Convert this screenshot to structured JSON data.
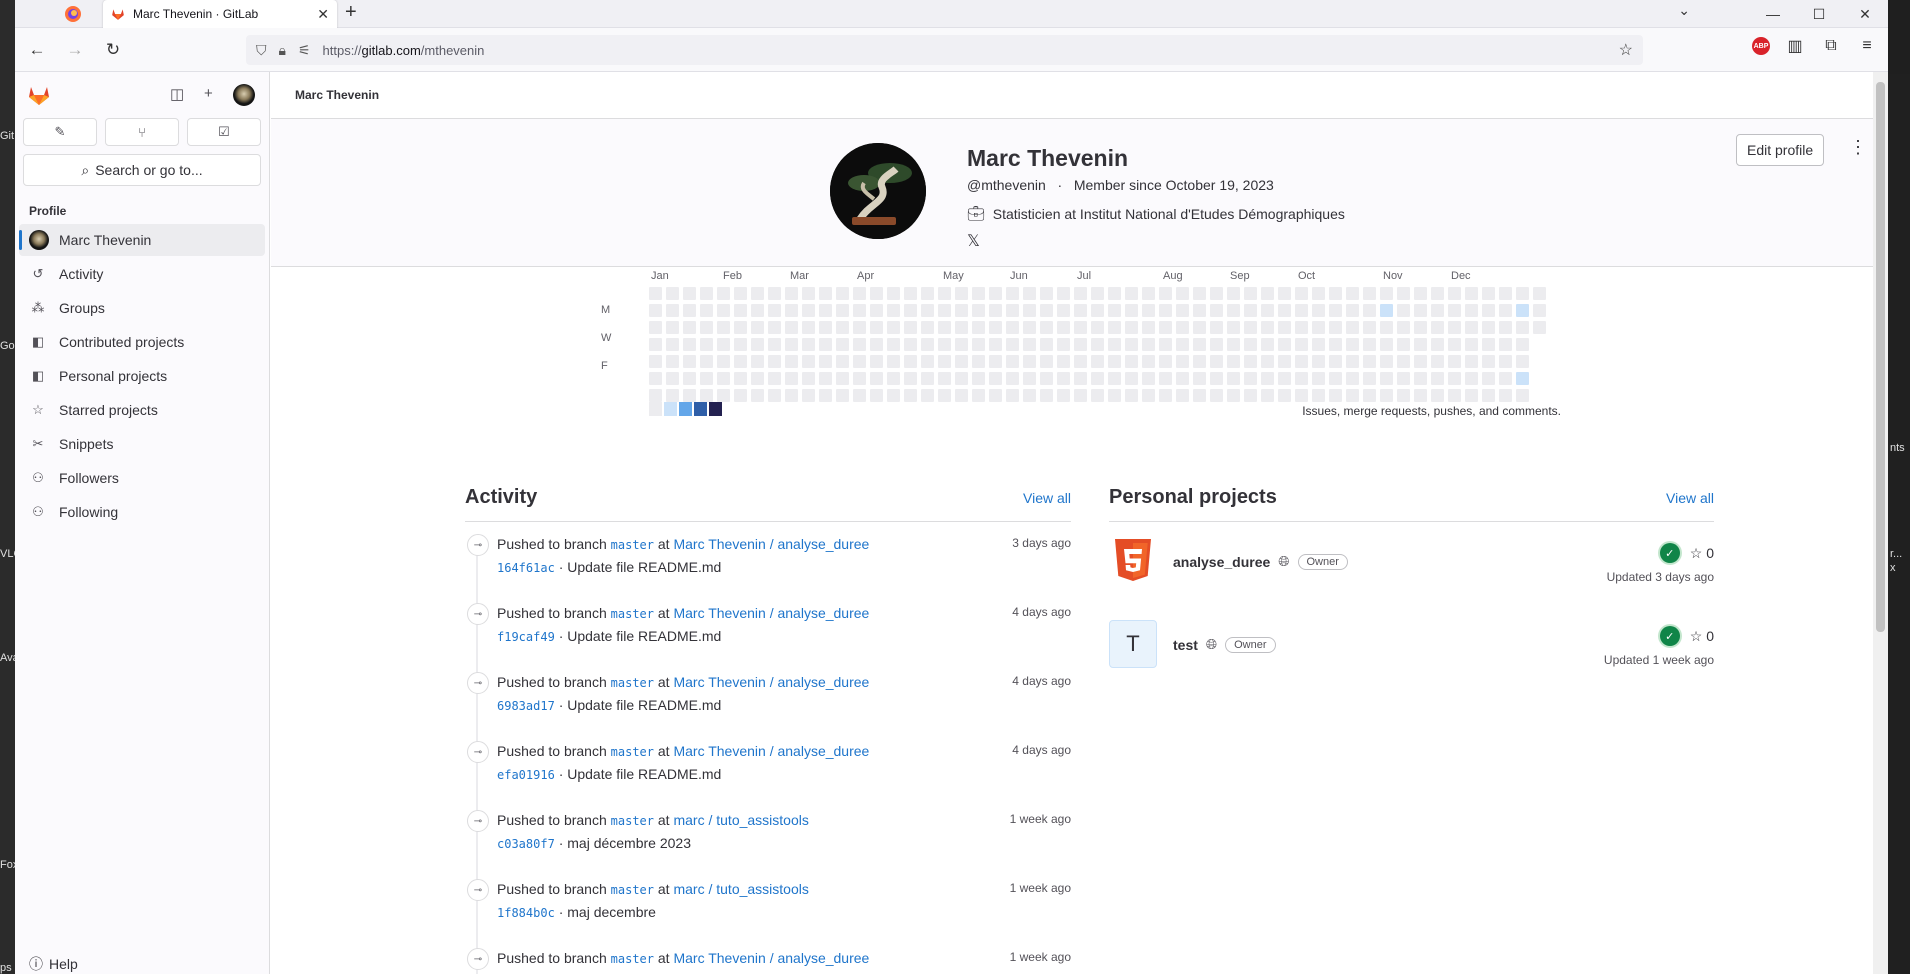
{
  "browser": {
    "tab_title": "Marc Thevenin · GitLab",
    "url_prefix": "https://",
    "url_host": "gitlab.com",
    "url_path": "/mthevenin"
  },
  "desktop_edge_labels": [
    "Git",
    "Go",
    "VLC",
    "Ava",
    "Fox",
    "ps"
  ],
  "desktop_edge_labels_right": [
    "nts",
    "r...",
    "x"
  ],
  "sidebar": {
    "search_placeholder": "Search or go to...",
    "section_label": "Profile",
    "items": [
      {
        "label": "Marc Thevenin",
        "icon": "avatar",
        "active": true
      },
      {
        "label": "Activity",
        "icon": "history-icon"
      },
      {
        "label": "Groups",
        "icon": "group-icon"
      },
      {
        "label": "Contributed projects",
        "icon": "project-icon"
      },
      {
        "label": "Personal projects",
        "icon": "project-icon"
      },
      {
        "label": "Starred projects",
        "icon": "star-icon"
      },
      {
        "label": "Snippets",
        "icon": "snippet-icon"
      },
      {
        "label": "Followers",
        "icon": "users-icon"
      },
      {
        "label": "Following",
        "icon": "users-icon"
      }
    ],
    "help_label": "Help"
  },
  "breadcrumb": "Marc Thevenin",
  "profile": {
    "name": "Marc Thevenin",
    "username": "@mthevenin",
    "member_since": "Member since October 19, 2023",
    "job": "Statisticien at Institut National d'Etudes Démographiques",
    "x_link": "𝕏",
    "edit_label": "Edit profile"
  },
  "calendar": {
    "months": [
      "Jan",
      "Feb",
      "Mar",
      "Apr",
      "May",
      "Jun",
      "Jul",
      "Aug",
      "Sep",
      "Oct",
      "Nov",
      "Dec"
    ],
    "day_labels": [
      "M",
      "W",
      "F"
    ],
    "legend_colors": [
      "#ececef",
      "#cbe2f9",
      "#63a6e9",
      "#2f5fa8",
      "#232150"
    ],
    "note": "Issues, merge requests, pushes, and comments.",
    "active_cells": [
      {
        "week": 43,
        "day": 1,
        "level": 1
      },
      {
        "week": 51,
        "day": 1,
        "level": 1
      },
      {
        "week": 51,
        "day": 5,
        "level": 1
      }
    ]
  },
  "activity": {
    "title": "Activity",
    "view_all": "View all",
    "events": [
      {
        "action": "Pushed to branch",
        "branch": "master",
        "at": "at",
        "project": "Marc Thevenin / analyse_duree",
        "time": "3 days ago",
        "sha": "164f61ac",
        "message": "· Update file README.md"
      },
      {
        "action": "Pushed to branch",
        "branch": "master",
        "at": "at",
        "project": "Marc Thevenin / analyse_duree",
        "time": "4 days ago",
        "sha": "f19caf49",
        "message": "· Update file README.md"
      },
      {
        "action": "Pushed to branch",
        "branch": "master",
        "at": "at",
        "project": "Marc Thevenin / analyse_duree",
        "time": "4 days ago",
        "sha": "6983ad17",
        "message": "· Update file README.md"
      },
      {
        "action": "Pushed to branch",
        "branch": "master",
        "at": "at",
        "project": "Marc Thevenin / analyse_duree",
        "time": "4 days ago",
        "sha": "efa01916",
        "message": "· Update file README.md"
      },
      {
        "action": "Pushed to branch",
        "branch": "master",
        "at": "at",
        "project": "marc / tuto_assistools",
        "time": "1 week ago",
        "sha": "c03a80f7",
        "message": "· maj décembre 2023"
      },
      {
        "action": "Pushed to branch",
        "branch": "master",
        "at": "at",
        "project": "marc / tuto_assistools",
        "time": "1 week ago",
        "sha": "1f884b0c",
        "message": "· maj decembre"
      },
      {
        "action": "Pushed to branch",
        "branch": "master",
        "at": "at",
        "project": "Marc Thevenin / analyse_duree",
        "time": "1 week ago",
        "sha": "",
        "message": ""
      }
    ]
  },
  "projects": {
    "title": "Personal projects",
    "view_all": "View all",
    "items": [
      {
        "name": "analyse_duree",
        "badge": "Owner",
        "stars": "0",
        "updated": "Updated 3 days ago",
        "icon": "html5-icon"
      },
      {
        "name": "test",
        "badge": "Owner",
        "stars": "0",
        "updated": "Updated 1 week ago",
        "icon_letter": "T"
      }
    ]
  }
}
